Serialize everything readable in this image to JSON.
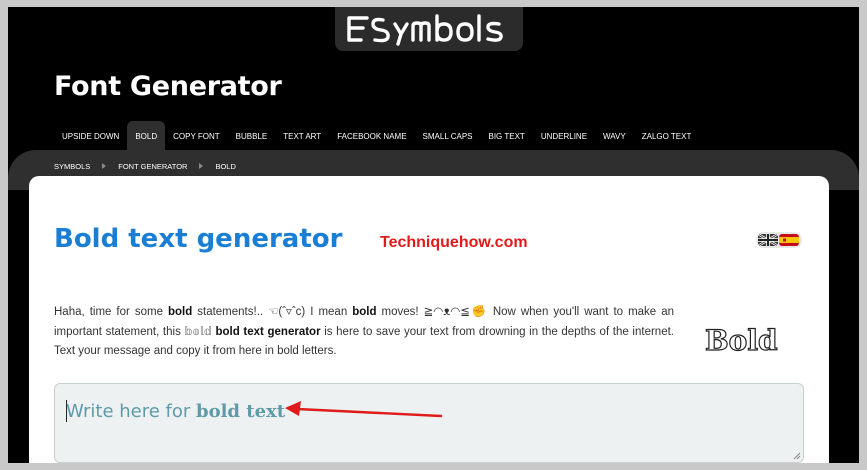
{
  "logo": {
    "text": "FSymbols"
  },
  "site_title": "Font Generator",
  "nav": {
    "items": [
      {
        "label": "UPSIDE DOWN",
        "active": false
      },
      {
        "label": "BOLD",
        "active": true
      },
      {
        "label": "COPY FONT",
        "active": false
      },
      {
        "label": "BUBBLE",
        "active": false
      },
      {
        "label": "TEXT ART",
        "active": false
      },
      {
        "label": "FACEBOOK NAME",
        "active": false
      },
      {
        "label": "SMALL CAPS",
        "active": false
      },
      {
        "label": "BIG TEXT",
        "active": false
      },
      {
        "label": "UNDERLINE",
        "active": false
      },
      {
        "label": "WAVY",
        "active": false
      },
      {
        "label": "ZALGO TEXT",
        "active": false
      }
    ]
  },
  "breadcrumbs": [
    "SYMBOLS",
    "FONT GENERATOR",
    "BOLD"
  ],
  "page": {
    "title": "Bold text generator",
    "watermark": "Techniquehow.com",
    "languages": [
      "English",
      "Español"
    ],
    "intro": {
      "t1": "Haha, time for some ",
      "b1": "bold",
      "t2": " statements!.. ☜(ˆ▿ˆc) I mean ",
      "b2": "bold",
      "t3": " moves! ≧◠ᴥ◠≦✊ Now when you'll want to make an important statement, this ",
      "fancy": "𝕓𝕠𝕝𝕕",
      "t4": " ",
      "b3": "bold text generator",
      "t5": " is here to save your text from drowning in the depths of the internet. Text your message and copy it from here in bold letters."
    },
    "sample_word": "Bold",
    "input": {
      "placeholder_prefix": "Write here for ",
      "placeholder_bold": "bold text",
      "value": ""
    }
  },
  "colors": {
    "title_blue": "#1a7fd4",
    "watermark_red": "#e01b1b",
    "placeholder_teal": "#5e9aa8",
    "arrow_red": "#e01b1b"
  }
}
